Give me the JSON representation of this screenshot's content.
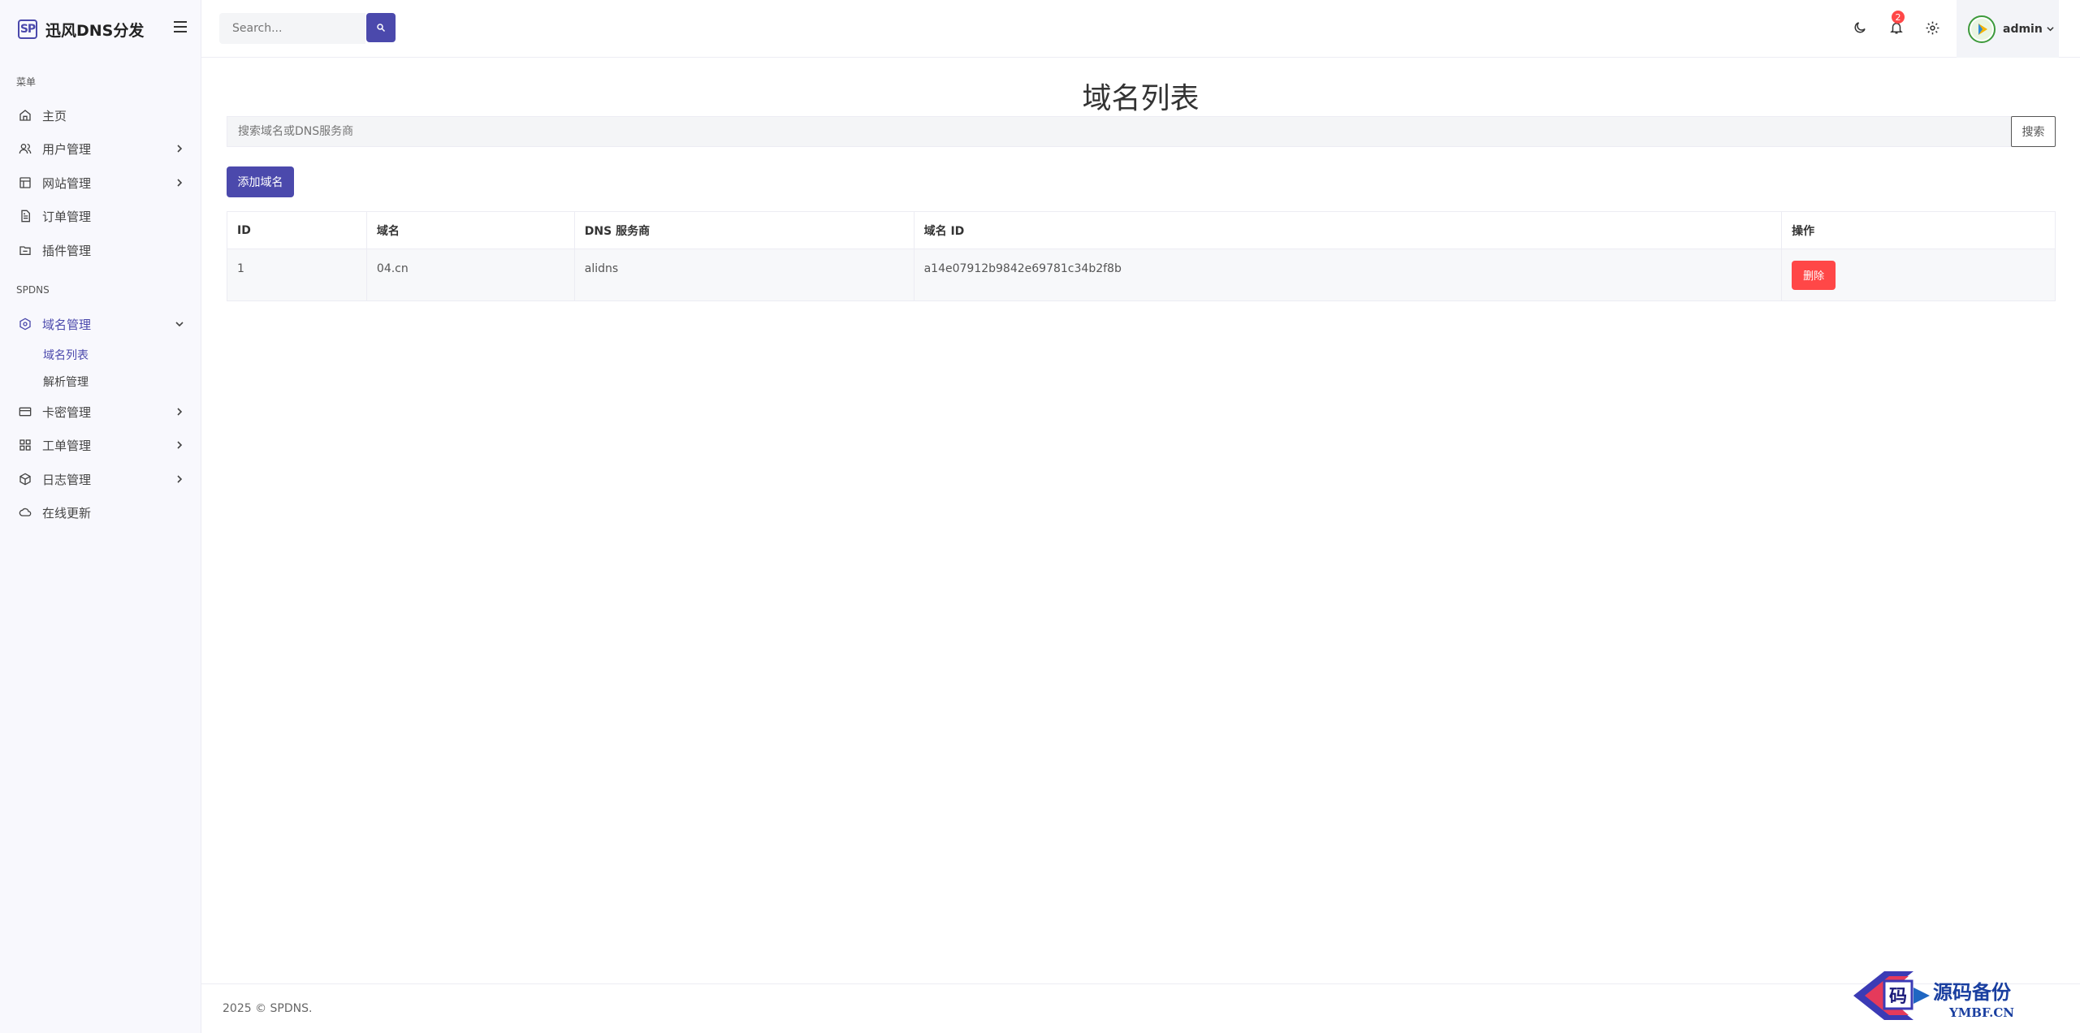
{
  "brand": {
    "logo_text": "SP",
    "name": "迅风DNS分发"
  },
  "sidebar": {
    "section_menu": "菜单",
    "section_spdns": "SPDNS",
    "items": [
      {
        "label": "主页"
      },
      {
        "label": "用户管理"
      },
      {
        "label": "网站管理"
      },
      {
        "label": "订单管理"
      },
      {
        "label": "插件管理"
      },
      {
        "label": "域名管理"
      },
      {
        "label": "卡密管理"
      },
      {
        "label": "工单管理"
      },
      {
        "label": "日志管理"
      },
      {
        "label": "在线更新"
      }
    ],
    "sub_items": [
      {
        "label": "域名列表"
      },
      {
        "label": "解析管理"
      }
    ]
  },
  "header": {
    "search_placeholder": "Search...",
    "notification_count": "2",
    "user_name": "admin"
  },
  "main": {
    "title": "域名列表",
    "filter_placeholder": "搜索域名或DNS服务商",
    "filter_button": "搜索",
    "add_button": "添加域名",
    "table": {
      "headers": [
        "ID",
        "域名",
        "DNS 服务商",
        "域名 ID",
        "操作"
      ],
      "rows": [
        {
          "id": "1",
          "domain": "04.cn",
          "provider": "alidns",
          "domain_id": "a14e07912b9842e69781c34b2f8b",
          "action": "删除"
        }
      ]
    }
  },
  "footer": {
    "text": "2025 © SPDNS."
  },
  "watermark": {
    "char": "码",
    "text": "源码备份",
    "sub": "YMBF.CN"
  },
  "colors": {
    "accent": "#4b49ac",
    "danger": "#ff4747"
  }
}
